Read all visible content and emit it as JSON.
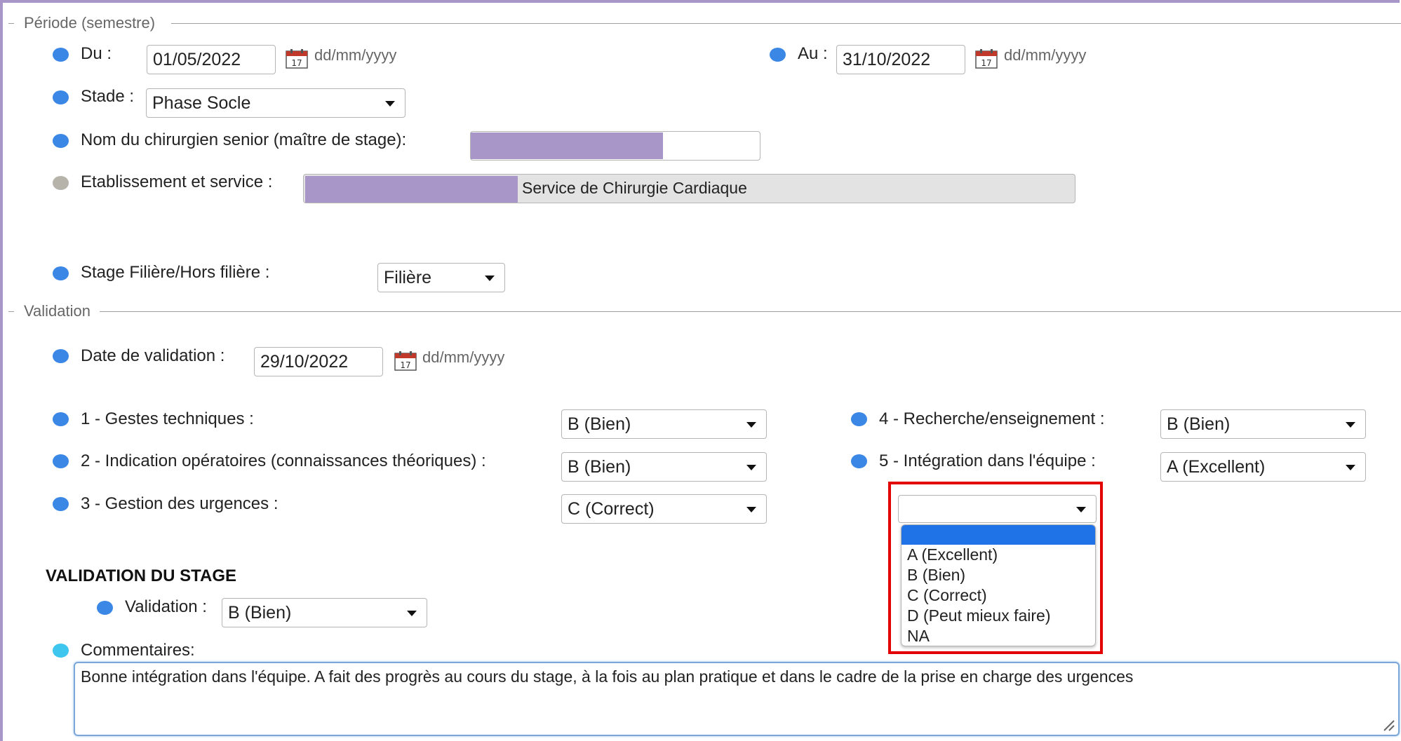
{
  "periode": {
    "legend": "Période (semestre)",
    "du_label": "Du :",
    "du_value": "01/05/2022",
    "au_label": "Au :",
    "au_value": "31/10/2022",
    "date_hint": "dd/mm/yyyy",
    "stade_label": "Stade :",
    "stade_value": "Phase Socle",
    "senior_label": "Nom du chirurgien senior (maître de stage):",
    "etab_label": "Etablissement et service :",
    "etab_value": "Service de Chirurgie Cardiaque",
    "filiere_label": "Stage Filière/Hors filière :",
    "filiere_value": "Filière"
  },
  "validation": {
    "legend": "Validation",
    "date_label": "Date de validation :",
    "date_value": "29/10/2022",
    "date_hint": "dd/mm/yyyy",
    "criteria": [
      {
        "label": "1 - Gestes techniques :",
        "value": "B (Bien)"
      },
      {
        "label": "2 - Indication opératoires (connaissances théoriques) :",
        "value": "B (Bien)"
      },
      {
        "label": "3 - Gestion des urgences :",
        "value": "C (Correct)"
      },
      {
        "label": "4 - Recherche/enseignement :",
        "value": "B (Bien)"
      },
      {
        "label": "5 - Intégration dans l'équipe :",
        "value": "A (Excellent)"
      }
    ],
    "dropdown": {
      "selected": "",
      "options": [
        "A (Excellent)",
        "B (Bien)",
        "C (Correct)",
        "D (Peut mieux faire)",
        "NA"
      ]
    },
    "stage_heading": "VALIDATION DU STAGE",
    "stage_label": "Validation :",
    "stage_value": "B (Bien)",
    "comments_label": "Commentaires:",
    "comments_value": "Bonne intégration dans l'équipe. A fait des progrès au cours du stage, à la fois au plan pratique et dans le cadre de la prise en charge des urgences"
  },
  "colors": {
    "dot_blue": "#3b87e6",
    "dot_grey": "#b6b3ab",
    "dot_cyan": "#3fc6ee",
    "highlight": "#e30000",
    "redaction": "#a896c8"
  }
}
